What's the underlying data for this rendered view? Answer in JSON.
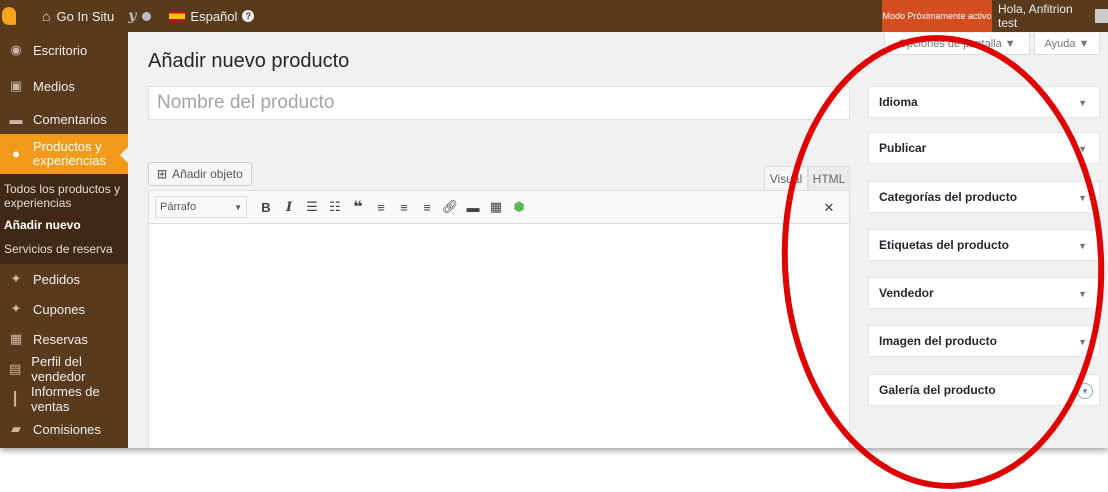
{
  "adminbar": {
    "site_name": "Go In Situ",
    "language": "Español",
    "help_mark": "?",
    "coming_soon": "Modo Próximamente activo",
    "greeting": "Hola, Anfitrion test"
  },
  "sidebar": {
    "items": [
      {
        "label": "Escritorio",
        "icon": "dashboard-icon"
      },
      {
        "label": "Medios",
        "icon": "media-icon"
      },
      {
        "label": "Comentarios",
        "icon": "comments-icon"
      },
      {
        "label": "Productos y experiencias",
        "icon": "products-icon",
        "current": true
      },
      {
        "label": "Pedidos",
        "icon": "pin-icon"
      },
      {
        "label": "Cupones",
        "icon": "pin-icon"
      },
      {
        "label": "Reservas",
        "icon": "calendar-icon"
      },
      {
        "label": "Perfil del vendedor",
        "icon": "profile-icon"
      },
      {
        "label": "Informes de ventas",
        "icon": "reports-icon"
      },
      {
        "label": "Comisiones",
        "icon": "commissions-icon"
      }
    ],
    "submenu": [
      {
        "label": "Todos los productos y experiencias"
      },
      {
        "label": "Añadir nuevo",
        "active": true
      },
      {
        "label": "Servicios de reserva"
      }
    ]
  },
  "main": {
    "page_title": "Añadir nuevo producto",
    "title_placeholder": "Nombre del producto",
    "add_media_label": "Añadir objeto",
    "tab_visual": "Visual",
    "tab_html": "HTML",
    "format_value": "Párrafo"
  },
  "right": {
    "screen_options": "Opciones de pantalla ▼",
    "help": "Ayuda ▼",
    "boxes": [
      {
        "label": "Idioma"
      },
      {
        "label": "Publicar"
      },
      {
        "label": "Categorías del producto"
      },
      {
        "label": "Etiquetas del producto"
      },
      {
        "label": "Vendedor"
      },
      {
        "label": "Imagen del producto"
      },
      {
        "label": "Galería del producto"
      }
    ]
  },
  "colors": {
    "adminbar": "#5a3a1c",
    "accent": "#f29b1a",
    "coming_soon": "#d54e21",
    "annotation": "#e00000"
  }
}
